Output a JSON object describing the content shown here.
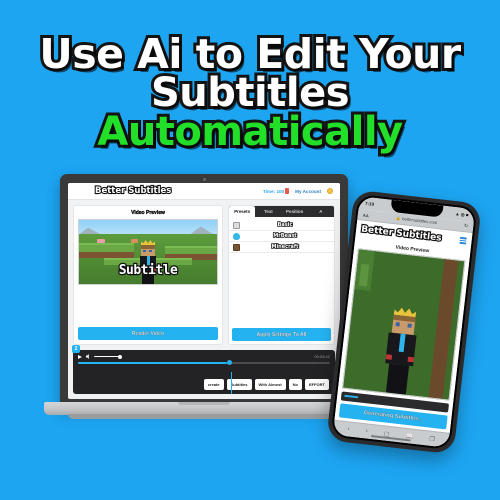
{
  "theme": {
    "background": "#1DA5F2",
    "accent": "#25B2F0",
    "highlight": "#22E02A",
    "outline": "#141414"
  },
  "headline": {
    "line1": "Use Ai to Edit Your",
    "line2_white": "Subtitles",
    "line2_green": "Automatically"
  },
  "laptop": {
    "app": {
      "brand": "Better Subtitles",
      "time_label": "Time: 100",
      "account_label": "My Account",
      "left_panel": {
        "title": "Video Preview",
        "subtitle_text": "Subtitle",
        "render_button": "Render Video"
      },
      "right_panel": {
        "tabs": [
          {
            "label": "Presets",
            "active": true
          },
          {
            "label": "Text",
            "active": false
          },
          {
            "label": "Position",
            "active": false
          },
          {
            "label": "A",
            "active": false
          }
        ],
        "presets": [
          {
            "icon": "square-icon",
            "label": "Basic"
          },
          {
            "icon": "droplet-icon",
            "label": "MrBeast"
          },
          {
            "icon": "dirt-block-icon",
            "label": "Minecraft"
          }
        ],
        "apply_button": "Apply Settings To All"
      },
      "timeline": {
        "badge": "2",
        "timecode": "00:03:42",
        "progress_percent": 59,
        "chips": [
          "create",
          "Subtitles",
          "With Almost",
          "No",
          "EFFORT"
        ]
      }
    }
  },
  "phone": {
    "status": {
      "time": "7:19",
      "signal": "signal-icon",
      "wifi": "wifi-icon",
      "battery": "battery-icon"
    },
    "browser": {
      "aa_label": "AA",
      "url": "bettersubtitles.com",
      "lock": "lock-icon",
      "reload": "reload-icon"
    },
    "app": {
      "brand": "Better Subtitles",
      "menu": "hamburger-menu-icon",
      "preview_title": "Video Preview",
      "generate_button": "Generating Subtitles..."
    },
    "nav": {
      "back": "‹",
      "forward": "›",
      "share": "share-icon",
      "bookmarks": "book-icon",
      "tabs": "tabs-icon"
    }
  }
}
